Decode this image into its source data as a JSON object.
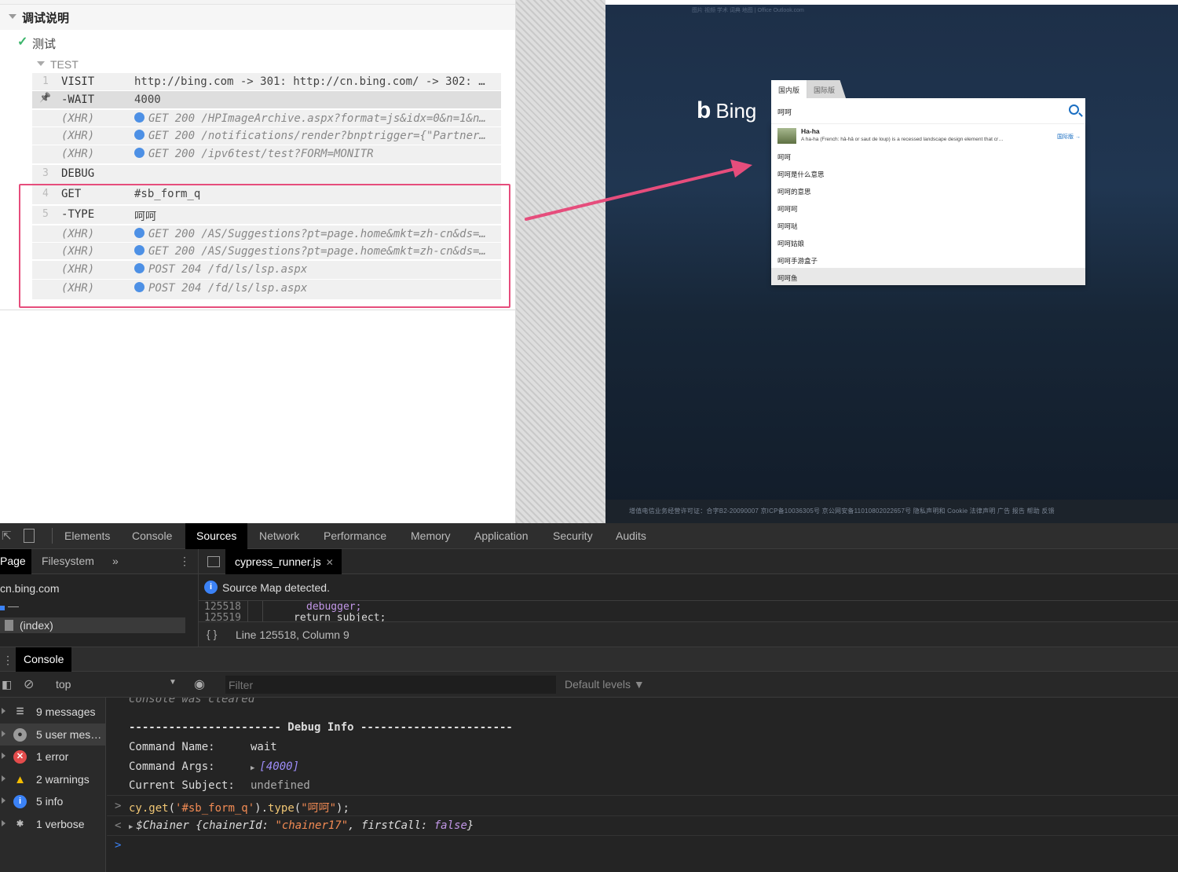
{
  "runner": {
    "suite_title": "调试说明",
    "test_title": "测试",
    "hook_title": "TEST",
    "commands": [
      {
        "num": "1",
        "name": "VISIT",
        "msg": "http://bing.com -> 301: http://cn.bing.com/ -> 302: …",
        "type": "cmd"
      },
      {
        "num": "",
        "name": "-WAIT",
        "msg": "4000",
        "type": "pinned"
      },
      {
        "num": "",
        "name": "(XHR)",
        "msg": "GET 200 /HPImageArchive.aspx?format=js&idx=0&n=1&n…",
        "type": "xhr"
      },
      {
        "num": "",
        "name": "(XHR)",
        "msg": "GET 200 /notifications/render?bnptrigger={\"Partner…",
        "type": "xhr"
      },
      {
        "num": "",
        "name": "(XHR)",
        "msg": "GET 200 /ipv6test/test?FORM=MONITR",
        "type": "xhr"
      },
      {
        "num": "3",
        "name": "DEBUG",
        "msg": "",
        "type": "cmd"
      },
      {
        "num": "4",
        "name": "GET",
        "msg": "#sb_form_q",
        "type": "cmd"
      },
      {
        "num": "5",
        "name": "-TYPE",
        "msg": "呵呵",
        "type": "cmd"
      },
      {
        "num": "",
        "name": "(XHR)",
        "msg": "GET 200 /AS/Suggestions?pt=page.home&mkt=zh-cn&ds=…",
        "type": "xhr"
      },
      {
        "num": "",
        "name": "(XHR)",
        "msg": "GET 200 /AS/Suggestions?pt=page.home&mkt=zh-cn&ds=…",
        "type": "xhr"
      },
      {
        "num": "",
        "name": "(XHR)",
        "msg": "POST 204 /fd/ls/lsp.aspx",
        "type": "xhr"
      },
      {
        "num": "",
        "name": "(XHR)",
        "msg": "POST 204 /fd/ls/lsp.aspx",
        "type": "xhr"
      }
    ]
  },
  "app": {
    "top_links": "图片    视频    学术    词典    地图    |    Office    Outlook.com",
    "logo_text": "Bing",
    "tabs": [
      "国内版",
      "国际版"
    ],
    "search_value": "呵呵",
    "rich_title": "Ha-ha",
    "rich_desc": "A ha-ha (French: hâ-hâ or saut de loup) is a recessed landscape design element that cr…",
    "rich_link": "国际版 →",
    "suggestions": [
      "呵呵",
      "呵呵是什么意思",
      "呵呵的意思",
      "呵呵呵",
      "呵呵哒",
      "呵呵姑娘",
      "呵呵手游盒子",
      "呵呵鱼"
    ],
    "footer": "增值电信业务经营许可证：合字B2-20090007    京ICP备10036305号    京公网安备11010802022657号    隐私声明和 Cookie    法律声明    广告    报告    帮助    反馈"
  },
  "devtools": {
    "tabs": [
      "Elements",
      "Console",
      "Sources",
      "Network",
      "Performance",
      "Memory",
      "Application",
      "Security",
      "Audits"
    ],
    "active_tab": "Sources",
    "nav_tabs": [
      "Page",
      "Filesystem",
      "»"
    ],
    "tree": {
      "domain": "cn.bing.com",
      "folder": "—",
      "file": "(index)"
    },
    "file_tab": "cypress_runner.js",
    "sourcemap": "Source Map detected.",
    "code_lines": [
      {
        "ln": "125518",
        "code": "debugger;"
      },
      {
        "ln": "125519",
        "code": "return subject;"
      }
    ],
    "status": "Line 125518, Column 9",
    "drawer_tab": "Console",
    "context": "top",
    "filter_placeholder": "Filter",
    "levels": "Default levels ▼",
    "sidebar": [
      {
        "label": "9 messages",
        "icon": "list-icon"
      },
      {
        "label": "5 user mes…",
        "icon": "user-icon"
      },
      {
        "label": "1 error",
        "icon": "error-icon"
      },
      {
        "label": "2 warnings",
        "icon": "warning-icon"
      },
      {
        "label": "5 info",
        "icon": "info-icon"
      },
      {
        "label": "1 verbose",
        "icon": "bug-icon"
      }
    ],
    "console": {
      "cleared": "Console was cleared",
      "debug_header": "----------------------- Debug Info -----------------------",
      "cmd_name_key": "Command Name:",
      "cmd_name_val": "wait",
      "cmd_args_key": "Command Args:",
      "cmd_args_val": "[4000]",
      "subject_key": "Current Subject:",
      "subject_val": "undefined",
      "input_line": "cy.get('#sb_form_q').type(\"呵呵\");",
      "result_prefix": "$Chainer {chainerId: ",
      "result_id": "\"chainer17\"",
      "result_mid": ", firstCall: ",
      "result_bool": "false",
      "result_end": "}"
    }
  },
  "colors": {
    "highlight": "#e64d7c",
    "xhr_dot": "#4d90e5",
    "pass": "#3bb56b"
  }
}
